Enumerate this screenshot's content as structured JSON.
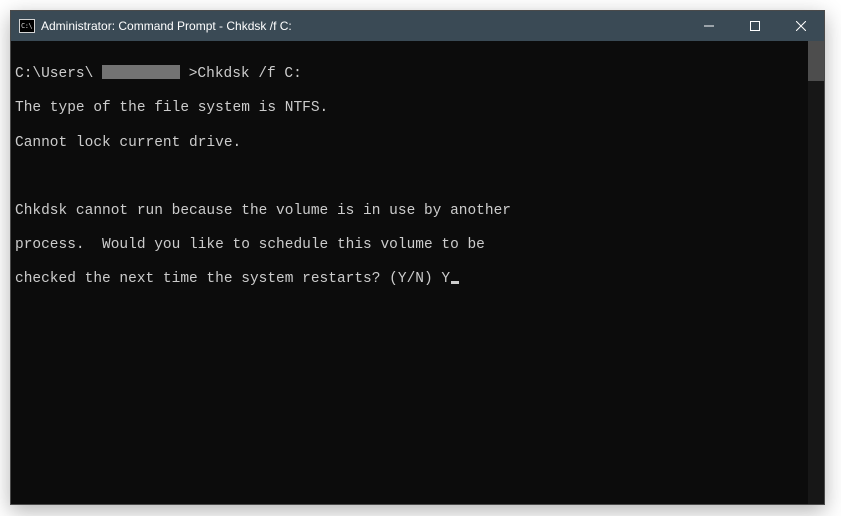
{
  "titlebar": {
    "icon_glyph": "C:\\",
    "title": "Administrator: Command Prompt - Chkdsk  /f C:"
  },
  "terminal": {
    "prompt_prefix": "C:\\Users\\ ",
    "prompt_suffix": " >",
    "command": "Chkdsk /f C:",
    "line2": "The type of the file system is NTFS.",
    "line3": "Cannot lock current drive.",
    "line5": "Chkdsk cannot run because the volume is in use by another",
    "line6": "process.  Would you like to schedule this volume to be",
    "line7": "checked the next time the system restarts? (Y/N) ",
    "response": "Y"
  }
}
